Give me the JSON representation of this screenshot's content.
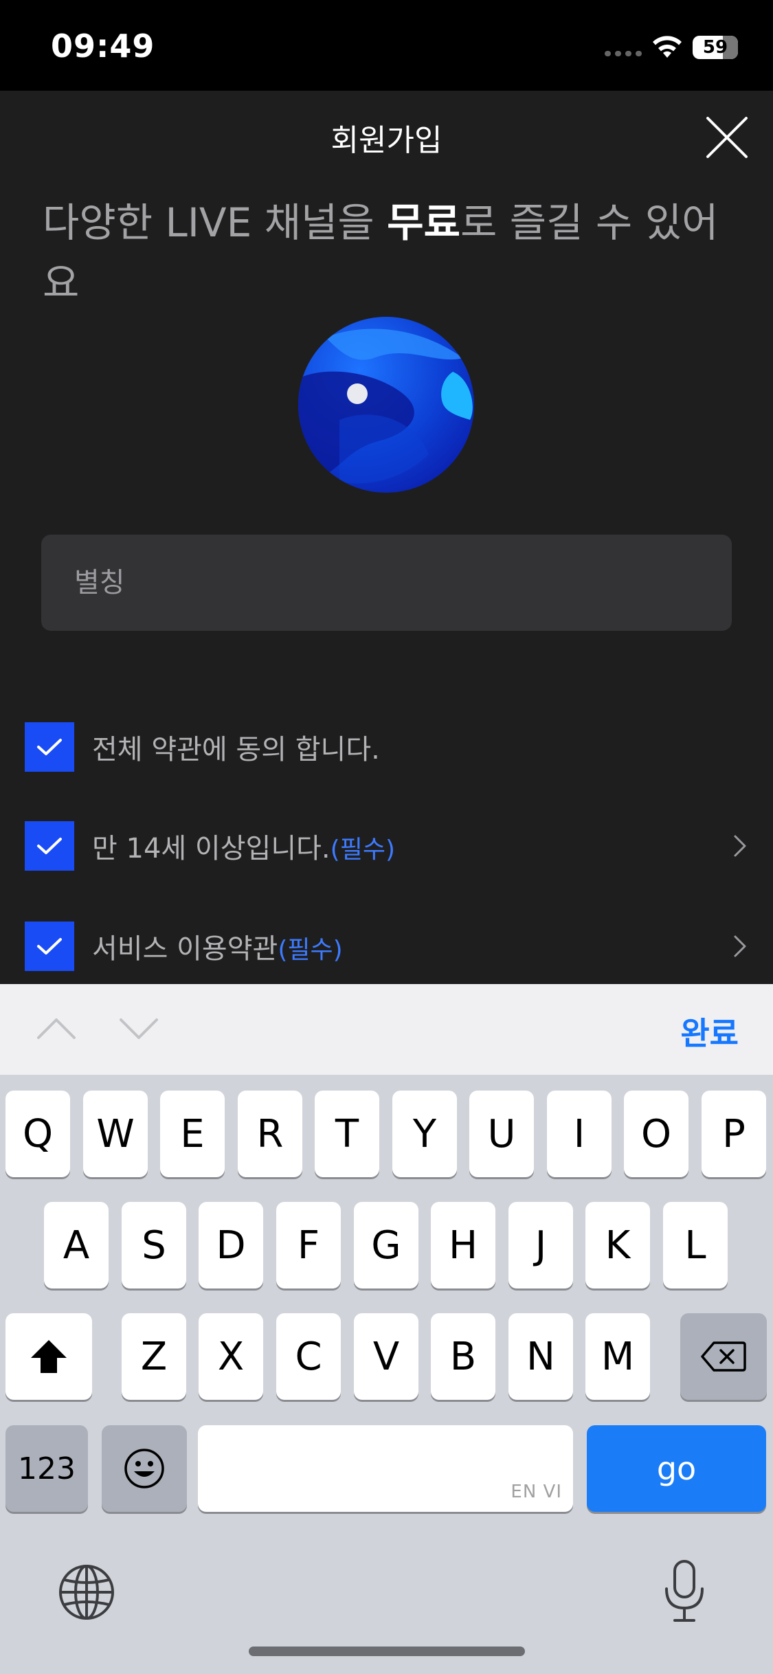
{
  "status_bar": {
    "time": "09:49",
    "battery": "59"
  },
  "header": {
    "title": "회원가입",
    "close_icon": "close-icon"
  },
  "headline": {
    "part1": "다양한 LIVE 채널을 ",
    "emphasis": "무료",
    "part2": "로 즐길 수 있어요"
  },
  "avatar": {
    "icon": "planet-avatar"
  },
  "nickname": {
    "placeholder": "별칭",
    "value": ""
  },
  "agreements": [
    {
      "label": "전체 약관에 동의 합니다.",
      "tag": "",
      "checked": true,
      "has_detail": false
    },
    {
      "label": "만 14세 이상입니다.",
      "tag": "(필수)",
      "checked": true,
      "has_detail": true
    },
    {
      "label": "서비스 이용약관",
      "tag": "(필수)",
      "checked": true,
      "has_detail": true
    }
  ],
  "keyboard_accessory": {
    "prev_icon": "chevron-up-icon",
    "next_icon": "chevron-down-icon",
    "done_label": "완료"
  },
  "keyboard": {
    "row1": [
      "Q",
      "W",
      "E",
      "R",
      "T",
      "Y",
      "U",
      "I",
      "O",
      "P"
    ],
    "row2": [
      "A",
      "S",
      "D",
      "F",
      "G",
      "H",
      "J",
      "K",
      "L"
    ],
    "row3": [
      "Z",
      "X",
      "C",
      "V",
      "B",
      "N",
      "M"
    ],
    "numbers_label": "123",
    "space_label": "EN VI",
    "go_label": "go"
  },
  "colors": {
    "accent_blue": "#1a4cf5",
    "required_blue": "#3d7bff",
    "go_blue": "#1a7df7"
  }
}
